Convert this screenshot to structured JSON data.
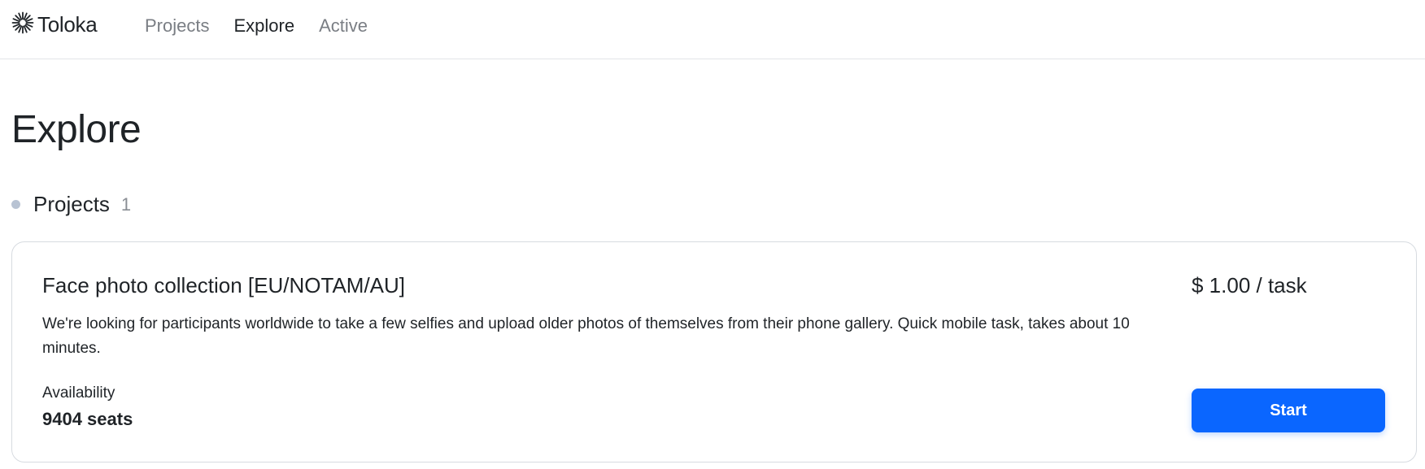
{
  "header": {
    "logo_text": "Toloka",
    "logo_icon": "toloka-sunburst-icon",
    "nav": [
      {
        "label": "Projects",
        "active": false
      },
      {
        "label": "Explore",
        "active": true
      },
      {
        "label": "Active",
        "active": false
      }
    ]
  },
  "page": {
    "title": "Explore"
  },
  "section": {
    "title": "Projects",
    "count": "1"
  },
  "project": {
    "title": "Face photo collection [EU/NOTAM/AU]",
    "description": "We're looking for participants worldwide to take a few selfies and upload older photos of themselves from their phone gallery. Quick mobile task, takes about 10 minutes.",
    "availability_label": "Availability",
    "availability_value": "9404 seats",
    "price": "$ 1.00 / task",
    "start_label": "Start"
  },
  "colors": {
    "accent": "#0a66ff",
    "text": "#1f2327",
    "muted": "#7a7e84",
    "border": "#d7dbe0"
  }
}
